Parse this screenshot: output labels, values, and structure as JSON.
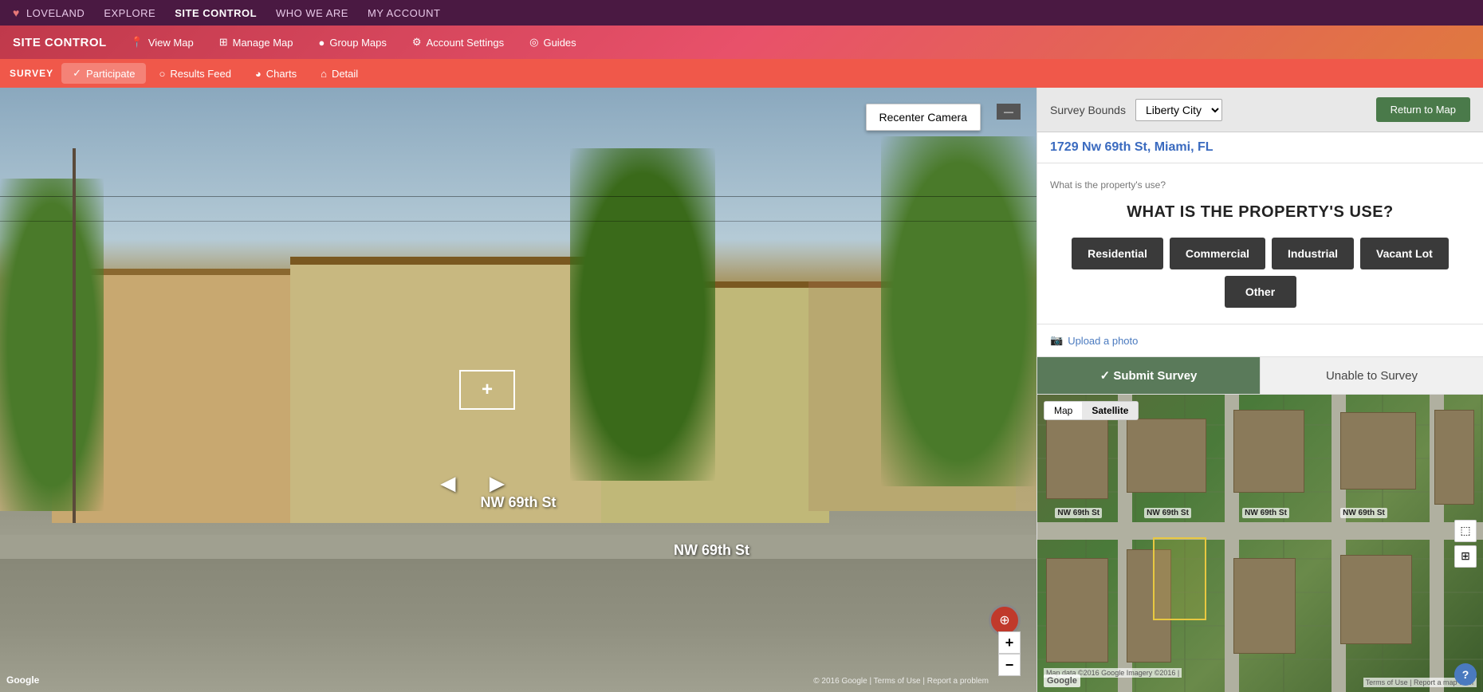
{
  "topNav": {
    "brand": "LOVELAND",
    "items": [
      {
        "label": "EXPLORE",
        "active": false
      },
      {
        "label": "SITE CONTROL",
        "active": true
      },
      {
        "label": "WHO WE ARE",
        "active": false
      },
      {
        "label": "MY ACCOUNT",
        "active": false
      }
    ]
  },
  "secondNav": {
    "siteControlLabel": "SITE CONTROL",
    "items": [
      {
        "label": "View Map",
        "icon": "📍"
      },
      {
        "label": "Manage Map",
        "icon": "⊞"
      },
      {
        "label": "Group Maps",
        "icon": "●"
      },
      {
        "label": "Account Settings",
        "icon": "⚙"
      },
      {
        "label": "Guides",
        "icon": "◎"
      }
    ]
  },
  "surveyTabs": {
    "surveyLabel": "SURVEY",
    "tabs": [
      {
        "label": "Participate",
        "icon": "✓",
        "active": true
      },
      {
        "label": "Results Feed",
        "icon": "○"
      },
      {
        "label": "Charts",
        "icon": "◕"
      },
      {
        "label": "Detail",
        "icon": "⌂"
      }
    ]
  },
  "streetView": {
    "recenterBtn": "Recenter Camera",
    "streetName1": "NW 69th St",
    "streetName2": "NW 69th St",
    "googleWatermark": "Google",
    "termsLink": "© 2016 Google | Terms of Use | Report a problem"
  },
  "rightPanel": {
    "surveyBoundsLabel": "Survey Bounds",
    "surveyBoundsValue": "Liberty City",
    "returnToMapBtn": "Return to Map",
    "address": "1729 Nw 69th St, Miami, FL",
    "breadcrumb": "What is the property's use?",
    "propertyUseTitle": "WHAT IS THE PROPERTY'S USE?",
    "useButtons": [
      {
        "label": "Residential"
      },
      {
        "label": "Commercial"
      },
      {
        "label": "Industrial"
      },
      {
        "label": "Vacant Lot"
      },
      {
        "label": "Other"
      }
    ],
    "uploadPhotoLink": "Upload a photo",
    "submitBtn": "✓ Submit Survey",
    "unableBtn": "Unable to Survey"
  },
  "map": {
    "tabs": [
      {
        "label": "Map",
        "active": false
      },
      {
        "label": "Satellite",
        "active": true
      }
    ],
    "streetLabels": [
      "NW 69th St",
      "NW 69th St",
      "NW 69th St",
      "NW 69th St"
    ],
    "googleLogo": "Google",
    "mapDataText": "Map data ©2016 Google Imagery ©2016 |",
    "termsText": "Terms of Use | Report a map error",
    "helpLabel": "?"
  },
  "colors": {
    "brand": "#4a1942",
    "navGradStart": "#c0394b",
    "navGradEnd": "#e07840",
    "tabsBar": "#f0584a",
    "submitGreen": "#5a7a5a",
    "returnGreen": "#4a7a4a",
    "addressBlue": "#3a6abf"
  }
}
